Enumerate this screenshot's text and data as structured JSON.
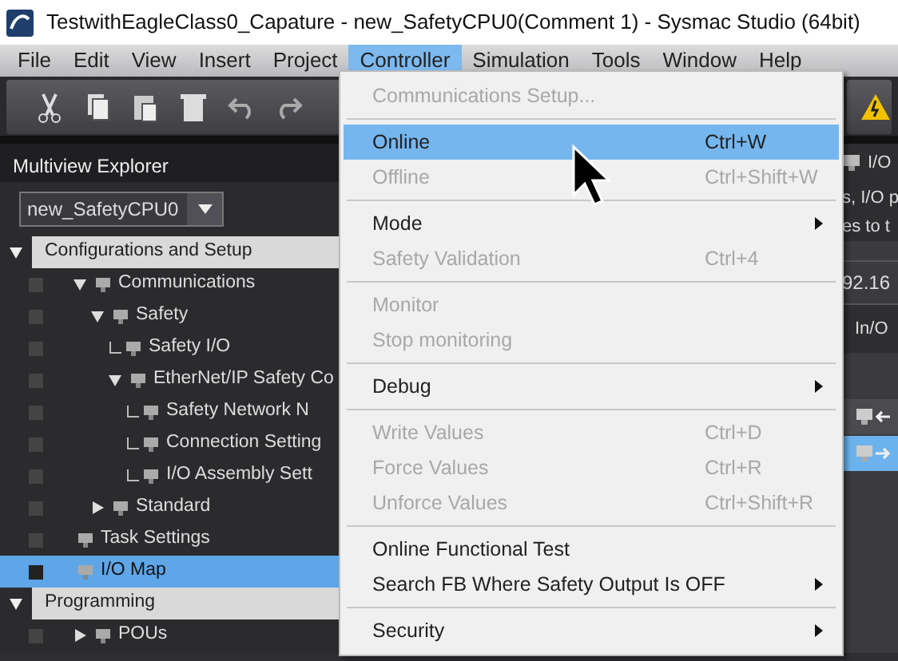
{
  "window": {
    "title": "TestwithEagleClass0_Capature - new_SafetyCPU0(Comment 1) - Sysmac Studio (64bit)"
  },
  "menubar": [
    {
      "label": "File",
      "selected": false
    },
    {
      "label": "Edit",
      "selected": false
    },
    {
      "label": "View",
      "selected": false
    },
    {
      "label": "Insert",
      "selected": false
    },
    {
      "label": "Project",
      "selected": false
    },
    {
      "label": "Controller",
      "selected": true
    },
    {
      "label": "Simulation",
      "selected": false
    },
    {
      "label": "Tools",
      "selected": false
    },
    {
      "label": "Window",
      "selected": false
    },
    {
      "label": "Help",
      "selected": false
    }
  ],
  "explorer": {
    "title": "Multiview Explorer",
    "device": "new_SafetyCPU0",
    "sections": [
      {
        "label": "Configurations and Setup",
        "expanded": true,
        "children": [
          {
            "label": "Communications",
            "expanded": true,
            "selected": false,
            "children": [
              {
                "label": "Safety",
                "expanded": true,
                "selected": false,
                "children": [
                  {
                    "label": "Safety I/O",
                    "selected": false
                  },
                  {
                    "label": "EtherNet/IP Safety Co",
                    "expanded": true,
                    "selected": false,
                    "children": [
                      {
                        "label": "Safety Network N",
                        "selected": false
                      },
                      {
                        "label": "Connection Setting",
                        "selected": false
                      },
                      {
                        "label": "I/O Assembly Sett",
                        "selected": false
                      }
                    ]
                  }
                ]
              },
              {
                "label": "Standard",
                "expanded": false,
                "selected": false
              }
            ]
          },
          {
            "label": "Task Settings",
            "selected": false
          },
          {
            "label": "I/O Map",
            "selected": true
          }
        ]
      },
      {
        "label": "Programming",
        "expanded": true,
        "children": [
          {
            "label": "POUs",
            "expanded": false,
            "selected": false
          }
        ]
      }
    ]
  },
  "right_panel": {
    "tab": "I/O",
    "lines": [
      "s, I/O p",
      "es to t"
    ],
    "address": "92.16",
    "column": "In/O",
    "rows": [
      {
        "kind": "input",
        "selected": false
      },
      {
        "kind": "output",
        "selected": true
      }
    ]
  },
  "menu": [
    {
      "kind": "item",
      "label": "Communications Setup...",
      "disabled": true,
      "selected": false
    },
    {
      "kind": "separator"
    },
    {
      "kind": "item",
      "label": "Online",
      "shortcut": "Ctrl+W",
      "disabled": false,
      "selected": true
    },
    {
      "kind": "item",
      "label": "Offline",
      "shortcut": "Ctrl+Shift+W",
      "disabled": true,
      "selected": false
    },
    {
      "kind": "separator"
    },
    {
      "kind": "submenu",
      "label": "Mode",
      "disabled": false,
      "selected": false
    },
    {
      "kind": "item",
      "label": "Safety Validation",
      "shortcut": "Ctrl+4",
      "disabled": true,
      "selected": false
    },
    {
      "kind": "separator"
    },
    {
      "kind": "item",
      "label": "Monitor",
      "disabled": true,
      "selected": false
    },
    {
      "kind": "item",
      "label": "Stop monitoring",
      "disabled": true,
      "selected": false
    },
    {
      "kind": "separator"
    },
    {
      "kind": "submenu",
      "label": "Debug",
      "disabled": false,
      "selected": false
    },
    {
      "kind": "separator"
    },
    {
      "kind": "item",
      "label": "Write Values",
      "shortcut": "Ctrl+D",
      "disabled": true,
      "selected": false
    },
    {
      "kind": "item",
      "label": "Force Values",
      "shortcut": "Ctrl+R",
      "disabled": true,
      "selected": false
    },
    {
      "kind": "item",
      "label": "Unforce Values",
      "shortcut": "Ctrl+Shift+R",
      "disabled": true,
      "selected": false
    },
    {
      "kind": "separator"
    },
    {
      "kind": "item",
      "label": "Online Functional Test",
      "disabled": false,
      "selected": false
    },
    {
      "kind": "submenu",
      "label": "Search FB Where Safety Output Is OFF",
      "disabled": false,
      "selected": false
    },
    {
      "kind": "separator"
    },
    {
      "kind": "submenu",
      "label": "Security",
      "disabled": false,
      "selected": false
    }
  ]
}
